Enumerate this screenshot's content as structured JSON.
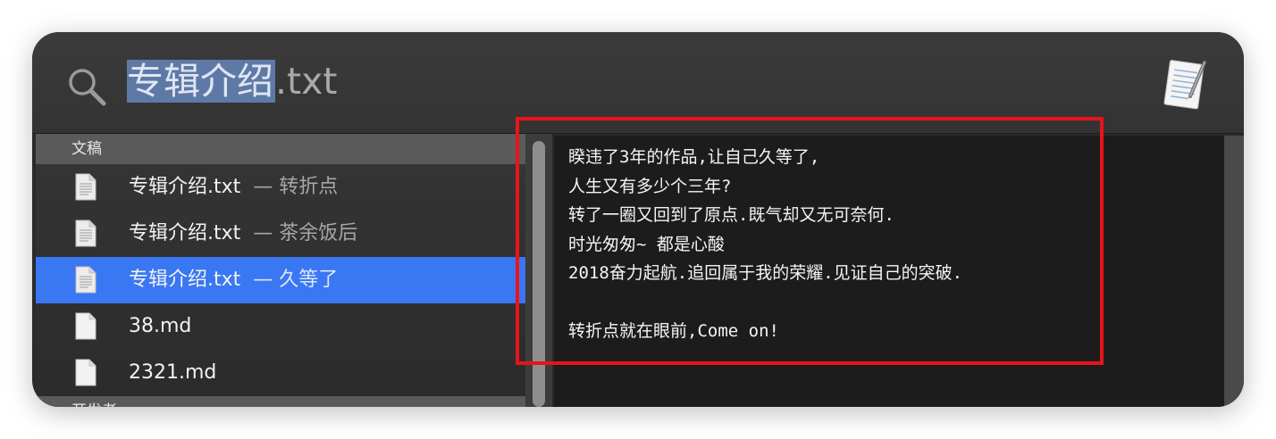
{
  "search": {
    "query_selected": "专辑介绍",
    "query_rest": ".txt"
  },
  "colors": {
    "selection_blue": "#3a77f2",
    "annotation_red": "#e8141b",
    "query_highlight": "#5e79a6"
  },
  "results": {
    "section_documents": "文稿",
    "items": [
      {
        "title": "专辑介绍.txt",
        "subtitle": "— 转折点",
        "icon": "text-document-icon",
        "selected": false
      },
      {
        "title": "专辑介绍.txt",
        "subtitle": "— 茶余饭后",
        "icon": "text-document-icon",
        "selected": false
      },
      {
        "title": "专辑介绍.txt",
        "subtitle": "— 久等了",
        "icon": "text-document-icon",
        "selected": true
      },
      {
        "title": "38.md",
        "subtitle": "",
        "icon": "blank-document-icon",
        "selected": false
      },
      {
        "title": "2321.md",
        "subtitle": "",
        "icon": "blank-document-icon",
        "selected": false
      }
    ],
    "section_developer": "开发者"
  },
  "preview": {
    "lines": [
      "睽违了3年的作品,让自己久等了,",
      "人生又有多少个三年?",
      "转了一圈又回到了原点.既气却又无可奈何.",
      "时光匆匆~ 都是心酸",
      "2018奋力起航.追回属于我的荣耀.见证自己的突破.",
      "",
      "转折点就在眼前,Come on!"
    ]
  }
}
